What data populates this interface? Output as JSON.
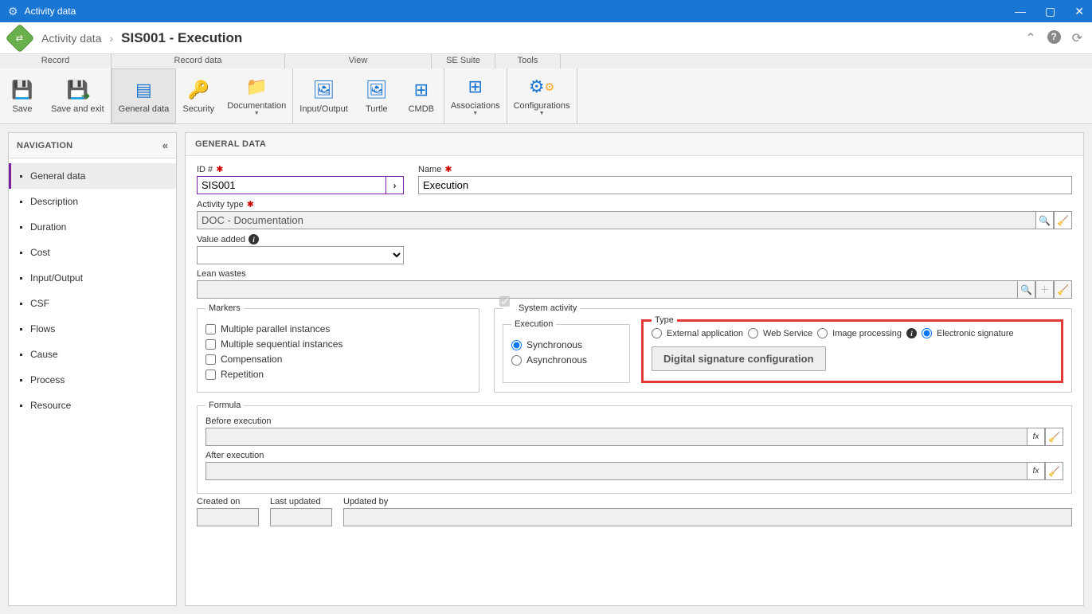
{
  "window": {
    "title": "Activity data"
  },
  "breadcrumb": {
    "part1": "Activity data",
    "part2": "SIS001 - Execution"
  },
  "ribbonTabs": {
    "record": "Record",
    "recordData": "Record data",
    "view": "View",
    "seSuite": "SE Suite",
    "tools": "Tools"
  },
  "ribbon": {
    "save": "Save",
    "saveExit": "Save and exit",
    "generalData": "General data",
    "security": "Security",
    "documentation": "Documentation",
    "inputOutput": "Input/Output",
    "turtle": "Turtle",
    "cmdb": "CMDB",
    "associations": "Associations",
    "configurations": "Configurations"
  },
  "nav": {
    "title": "NAVIGATION",
    "items": [
      "General data",
      "Description",
      "Duration",
      "Cost",
      "Input/Output",
      "CSF",
      "Flows",
      "Cause",
      "Process",
      "Resource"
    ]
  },
  "section": {
    "title": "GENERAL DATA"
  },
  "form": {
    "idLabel": "ID #",
    "idValue": "SIS001",
    "nameLabel": "Name",
    "nameValue": "Execution",
    "activityTypeLabel": "Activity type",
    "activityTypeValue": "DOC - Documentation",
    "valueAddedLabel": "Value added",
    "leanWastesLabel": "Lean wastes",
    "markersLegend": "Markers",
    "mk1": "Multiple parallel instances",
    "mk2": "Multiple sequential instances",
    "mk3": "Compensation",
    "mk4": "Repetition",
    "systemActivityLabel": "System activity",
    "executionLegend": "Execution",
    "sync": "Synchronous",
    "async": "Asynchronous",
    "typeLegend": "Type",
    "extApp": "External application",
    "webService": "Web Service",
    "imgProc": "Image processing",
    "esig": "Electronic signature",
    "dsigBtn": "Digital signature configuration",
    "formulaLegend": "Formula",
    "beforeExec": "Before execution",
    "afterExec": "After execution",
    "createdOn": "Created on",
    "lastUpdated": "Last updated",
    "updatedBy": "Updated by"
  }
}
